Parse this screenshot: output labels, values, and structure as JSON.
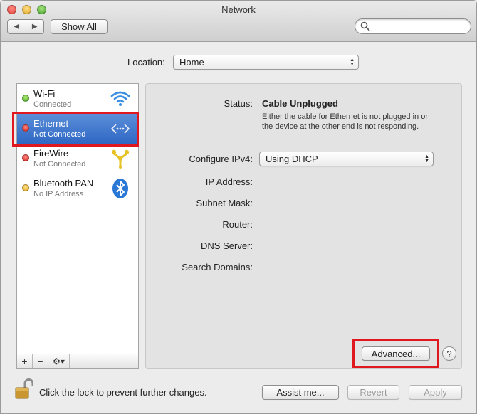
{
  "window": {
    "title": "Network"
  },
  "toolbar": {
    "back_label": "◀",
    "forward_label": "▶",
    "show_all_label": "Show All",
    "search": {
      "value": "",
      "placeholder": ""
    }
  },
  "location": {
    "label": "Location:",
    "selected": "Home"
  },
  "services": [
    {
      "name": "Wi-Fi",
      "status": "Connected",
      "status_color": "green",
      "icon": "wifi-icon"
    },
    {
      "name": "Ethernet",
      "status": "Not Connected",
      "status_color": "red",
      "icon": "ethernet-icon",
      "selected": true
    },
    {
      "name": "FireWire",
      "status": "Not Connected",
      "status_color": "red",
      "icon": "firewire-icon"
    },
    {
      "name": "Bluetooth PAN",
      "status": "No IP Address",
      "status_color": "yellow",
      "icon": "bluetooth-icon"
    }
  ],
  "sidebar_footer": {
    "add_label": "+",
    "remove_label": "−",
    "action_label": "⚙▾"
  },
  "detail": {
    "status_label": "Status:",
    "status_value": "Cable Unplugged",
    "status_description": "Either the cable for Ethernet is not plugged in or the device at the other end is not responding.",
    "configure_label": "Configure IPv4:",
    "configure_value": "Using DHCP",
    "ip_label": "IP Address:",
    "subnet_label": "Subnet Mask:",
    "router_label": "Router:",
    "dns_label": "DNS Server:",
    "search_domains_label": "Search Domains:",
    "advanced_label": "Advanced...",
    "help_label": "?"
  },
  "footer": {
    "lock_text": "Click the lock to prevent further changes.",
    "assist_label": "Assist me...",
    "revert_label": "Revert",
    "apply_label": "Apply"
  },
  "colors": {
    "highlight": "#e0171e",
    "selection": "#3a72cc"
  }
}
